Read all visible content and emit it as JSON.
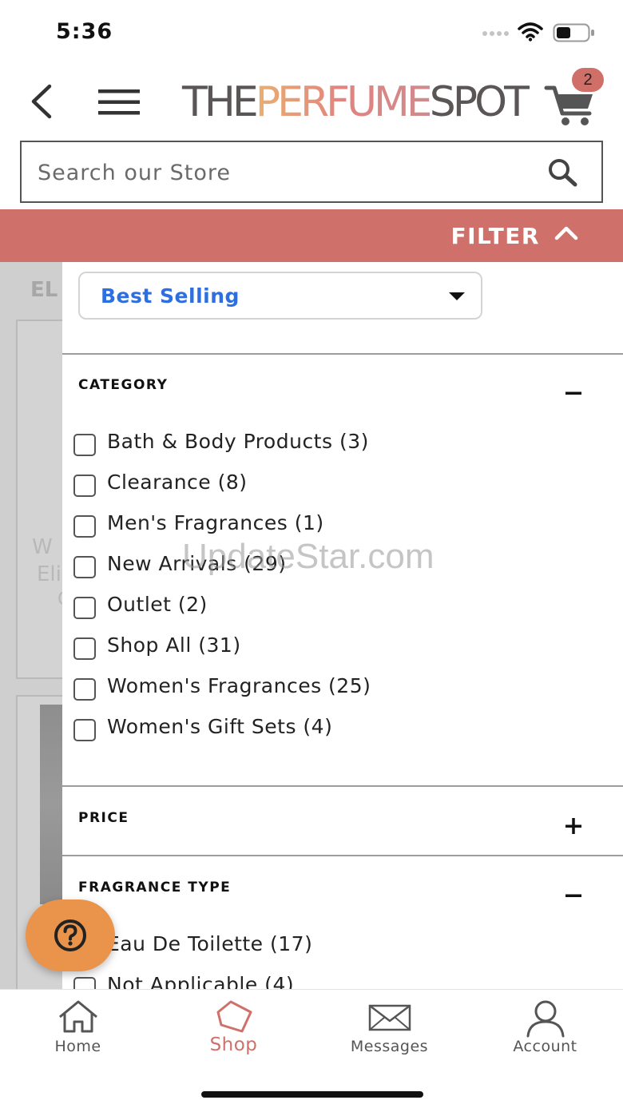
{
  "status_bar": {
    "time": "5:36"
  },
  "header": {
    "logo_part1": "THE",
    "logo_part2": "PERFUME",
    "logo_part3": "SPOT",
    "cart_count": "2"
  },
  "search": {
    "placeholder": "Search our Store",
    "value": ""
  },
  "filter_bar": {
    "label": "FILTER"
  },
  "background": {
    "heading": "EL",
    "card_line1": "W",
    "card_line2": "Eli",
    "card_line3": "G"
  },
  "sort": {
    "selected": "Best Selling"
  },
  "sections": {
    "category": {
      "title": "CATEGORY",
      "expanded": true,
      "options": [
        {
          "label": "Bath & Body Products (3)",
          "checked": false
        },
        {
          "label": "Clearance (8)",
          "checked": false
        },
        {
          "label": "Men's Fragrances (1)",
          "checked": false
        },
        {
          "label": "New Arrivals (29)",
          "checked": false
        },
        {
          "label": "Outlet (2)",
          "checked": false
        },
        {
          "label": "Shop All (31)",
          "checked": false
        },
        {
          "label": "Women's Fragrances (25)",
          "checked": false
        },
        {
          "label": "Women's Gift Sets (4)",
          "checked": false
        }
      ]
    },
    "price": {
      "title": "PRICE",
      "expanded": false
    },
    "fragrance_type": {
      "title": "FRAGRANCE TYPE",
      "expanded": true,
      "options": [
        {
          "label": "Eau De Toilette (17)",
          "checked": false
        },
        {
          "label": "Not Applicable (4)",
          "checked": false
        }
      ]
    }
  },
  "watermark": "UpdateStar.com",
  "bottom_nav": {
    "items": [
      {
        "label": "Home",
        "icon": "home-icon",
        "active": false
      },
      {
        "label": "Shop",
        "icon": "tag-icon",
        "active": true
      },
      {
        "label": "Messages",
        "icon": "envelope-icon",
        "active": false
      },
      {
        "label": "Account",
        "icon": "user-icon",
        "active": false
      }
    ]
  },
  "colors": {
    "accent": "#cf706a",
    "sort_text": "#2d6fe0",
    "help_button": "#e9944a"
  }
}
